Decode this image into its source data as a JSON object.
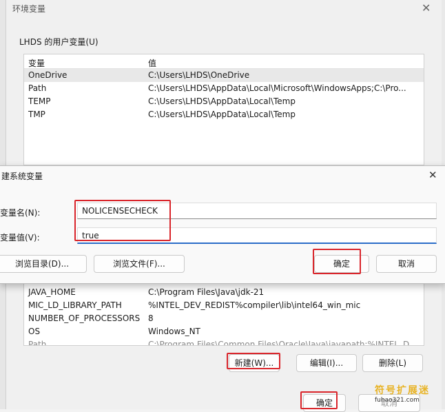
{
  "env_dialog": {
    "title": "环境变量",
    "close_glyph": "✕",
    "user_group_label": "LHDS 的用户变量(U)",
    "columns": {
      "name": "变量",
      "value": "值"
    },
    "user_vars": [
      {
        "name": "OneDrive",
        "value": "C:\\Users\\LHDS\\OneDrive"
      },
      {
        "name": "Path",
        "value": "C:\\Users\\LHDS\\AppData\\Local\\Microsoft\\WindowsApps;C:\\Pro..."
      },
      {
        "name": "TEMP",
        "value": "C:\\Users\\LHDS\\AppData\\Local\\Temp"
      },
      {
        "name": "TMP",
        "value": "C:\\Users\\LHDS\\AppData\\Local\\Temp"
      }
    ],
    "system_vars": [
      {
        "name": "JAVA_HOME",
        "value": "C:\\Program Files\\Java\\jdk-21"
      },
      {
        "name": "MIC_LD_LIBRARY_PATH",
        "value": "%INTEL_DEV_REDIST%compiler\\lib\\intel64_win_mic"
      },
      {
        "name": "NUMBER_OF_PROCESSORS",
        "value": "8"
      },
      {
        "name": "OS",
        "value": "Windows_NT"
      },
      {
        "name": "Path",
        "value": "C:\\Program Files\\Common Files\\Oracle\\Java\\javapath;%INTEL_D..."
      }
    ],
    "new_button": "新建(W)...",
    "edit_button": "编辑(I)...",
    "delete_button": "删除(L)",
    "ok_button": "确定",
    "cancel_button": "取消"
  },
  "new_var_dialog": {
    "title": "建系统变量",
    "close_glyph": "✕",
    "name_label": "变量名(N):",
    "name_value": "NOLICENSECHECK",
    "value_label": "变量值(V):",
    "value_value": "true",
    "browse_dir_button": "浏览目录(D)...",
    "browse_file_button": "浏览文件(F)...",
    "ok_button": "确定",
    "cancel_button": "取消"
  },
  "watermark": {
    "line1": "符号扩展迷",
    "line2": "fuhao321.com"
  },
  "colors": {
    "highlight_red": "#d9242a",
    "watermark_gold": "#e8b325"
  }
}
